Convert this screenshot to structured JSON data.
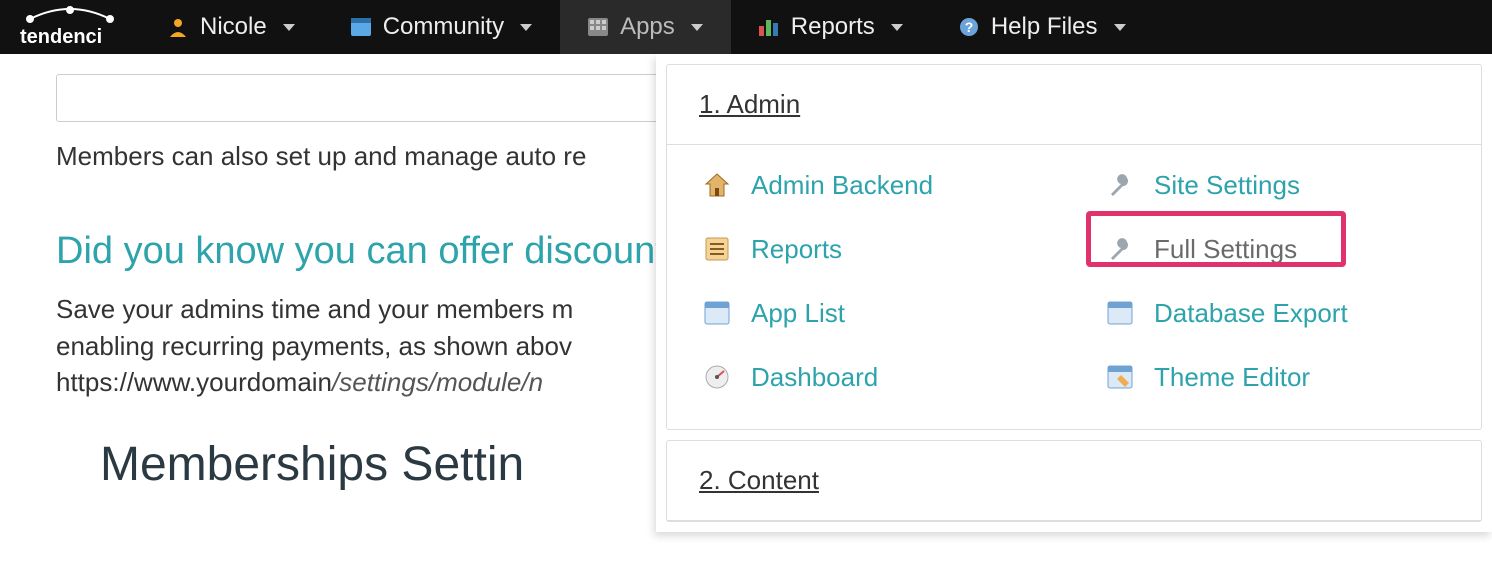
{
  "brand": "tendenci",
  "nav": {
    "user": "Nicole",
    "community": "Community",
    "apps": "Apps",
    "reports": "Reports",
    "help": "Help Files"
  },
  "page": {
    "intro_line": "Members can also set up and manage auto re",
    "discount_heading": "Did you know you can offer discount",
    "para1": "Save your admins time and your members m",
    "para2": "enabling recurring payments, as shown abov",
    "settings_path_prefix": "https://www.yourdomain",
    "settings_path_italic": "/settings/module/n",
    "memberships_title": "Memberships Settin"
  },
  "dropdown": {
    "section1_title": "1. Admin",
    "section2_title": "2. Content",
    "left": [
      {
        "label": "Admin Backend",
        "icon": "house-icon"
      },
      {
        "label": "Reports",
        "icon": "list-icon"
      },
      {
        "label": "App List",
        "icon": "window-icon"
      },
      {
        "label": "Dashboard",
        "icon": "dashboard-icon"
      }
    ],
    "right": [
      {
        "label": "Site Settings",
        "icon": "wrench-icon"
      },
      {
        "label": "Full Settings",
        "icon": "wrench-icon",
        "highlighted": true
      },
      {
        "label": "Database Export",
        "icon": "window-icon"
      },
      {
        "label": "Theme Editor",
        "icon": "theme-icon"
      }
    ]
  }
}
